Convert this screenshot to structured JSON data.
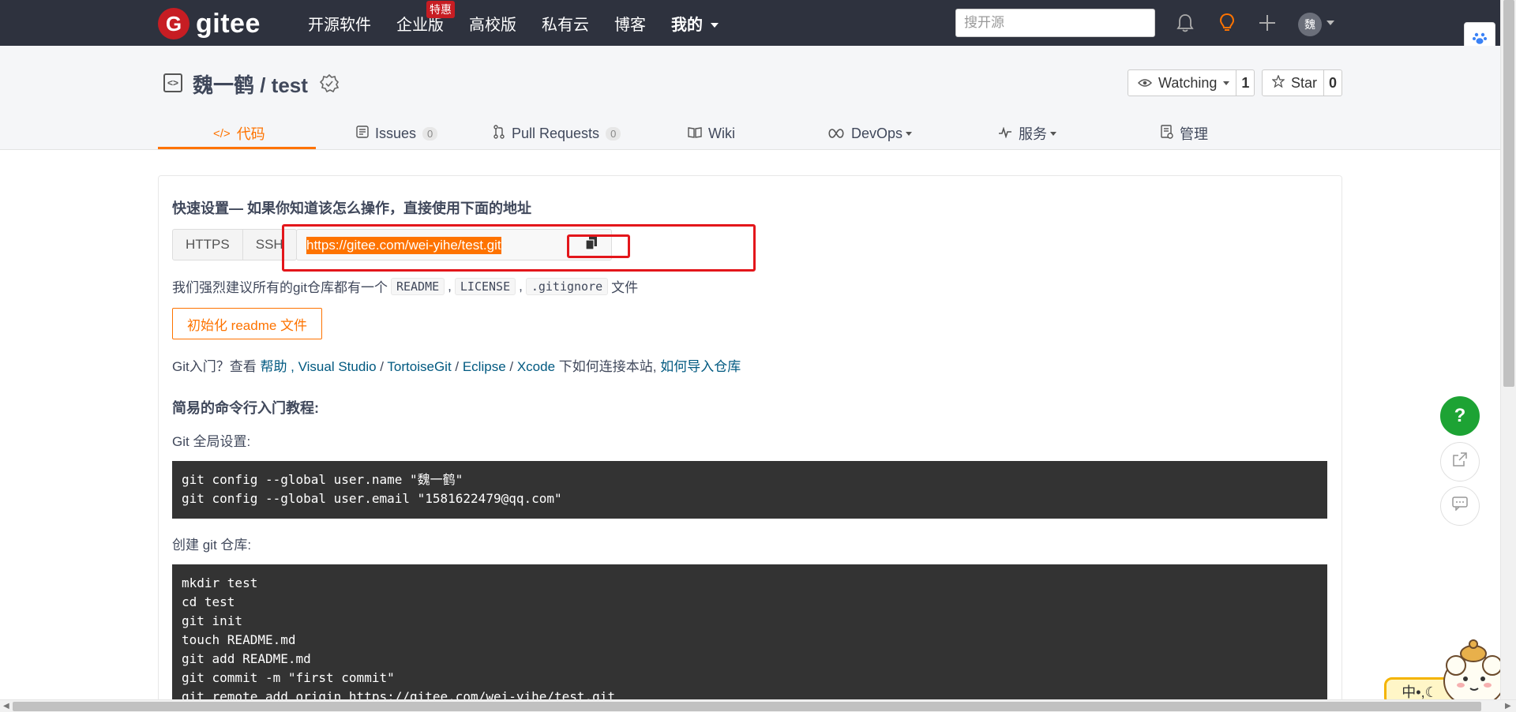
{
  "navbar": {
    "logo_mark": "G",
    "logo_text": "gitee",
    "links": [
      {
        "label": "开源软件"
      },
      {
        "label": "企业版",
        "badge": "特惠"
      },
      {
        "label": "高校版"
      },
      {
        "label": "私有云"
      },
      {
        "label": "博客"
      },
      {
        "label": "我的"
      }
    ],
    "search_placeholder": "搜开源",
    "avatar_text": "魏"
  },
  "repo": {
    "title": "魏一鹤 / test",
    "watch_label": "Watching",
    "watch_count": "1",
    "star_label": "Star",
    "star_count": "0"
  },
  "tabs": [
    {
      "label": "代码",
      "icon": "code-icon"
    },
    {
      "label": "Issues",
      "count": "0",
      "icon": "issues-icon"
    },
    {
      "label": "Pull Requests",
      "count": "0",
      "icon": "pull-request-icon"
    },
    {
      "label": "Wiki",
      "icon": "wiki-icon"
    },
    {
      "label": "DevOps",
      "icon": "devops-icon"
    },
    {
      "label": "服务",
      "icon": "service-icon"
    },
    {
      "label": "管理",
      "icon": "manage-icon"
    }
  ],
  "quick_setup": {
    "title": "快速设置— 如果你知道该怎么操作，直接使用下面的地址",
    "protocols": [
      "HTTPS",
      "SSH"
    ],
    "url": "https://gitee.com/wei-yihe/test.git",
    "recommend_text": "我们强烈建议所有的git仓库都有一个",
    "files": [
      "README",
      "LICENSE",
      ".gitignore"
    ],
    "recommend_suffix": "文件",
    "init_button": "初始化 readme 文件"
  },
  "help": {
    "prefix": "Git入门？查看 ",
    "link_help": "帮助",
    "comma": " , ",
    "link_vs": "Visual Studio",
    "sep1": " / ",
    "link_tortoise": "TortoiseGit",
    "sep2": " / ",
    "link_eclipse": "Eclipse",
    "sep3": " / ",
    "link_xcode": "Xcode",
    "suffix": " 下如何连接本站, ",
    "link_import": "如何导入仓库"
  },
  "tutorial": {
    "title": "简易的命令行入门教程:",
    "global_title": "Git 全局设置:",
    "global_code": "git config --global user.name \"魏一鹤\"\ngit config --global user.email \"1581622479@qq.com\"",
    "create_title": "创建 git 仓库:",
    "create_code": "mkdir test\ncd test\ngit init\ntouch README.md\ngit add README.md\ngit commit -m \"first commit\"\ngit remote add origin https://gitee.com/wei-yihe/test.git"
  },
  "fab": {
    "help_label": "?"
  },
  "ime": {
    "label": "中•,☾"
  },
  "colors": {
    "navbar": "#2e323e",
    "accent": "#fe7300",
    "brand_red": "#c71d23",
    "annotation_red": "#e3161b",
    "link": "#005980",
    "code_bg": "#333333"
  }
}
